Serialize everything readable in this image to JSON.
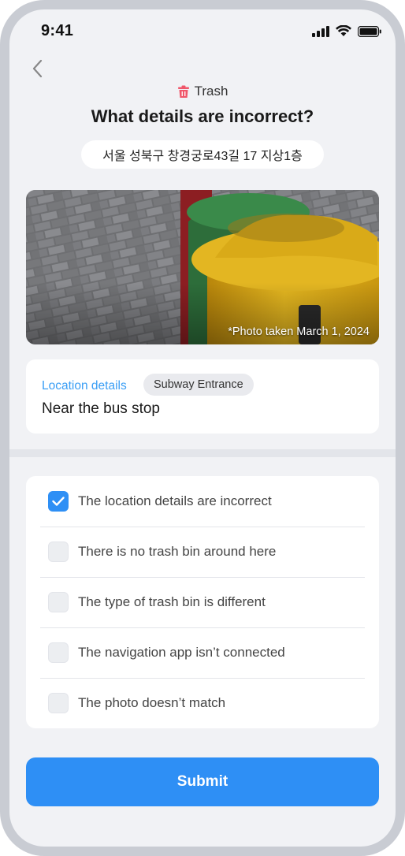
{
  "status_bar": {
    "time": "9:41"
  },
  "header": {
    "category_icon": "trash-icon",
    "category": "Trash",
    "title": "What details are incorrect?",
    "address": "서울 성북구 창경궁로43길 17 지상1층"
  },
  "photo": {
    "caption": "*Photo taken March 1, 2024"
  },
  "location": {
    "label": "Location details",
    "tag": "Subway Entrance",
    "value": "Near the bus stop"
  },
  "options": [
    {
      "label": "The location details are incorrect",
      "checked": true
    },
    {
      "label": "There is no trash bin around here",
      "checked": false
    },
    {
      "label": "The type of trash bin is different",
      "checked": false
    },
    {
      "label": "The navigation app isn’t connected",
      "checked": false
    },
    {
      "label": "The photo doesn’t match",
      "checked": false
    }
  ],
  "submit_label": "Submit",
  "colors": {
    "accent": "#2e8ff5",
    "label_blue": "#3a9ef5",
    "trash_icon": "#f0566a"
  }
}
